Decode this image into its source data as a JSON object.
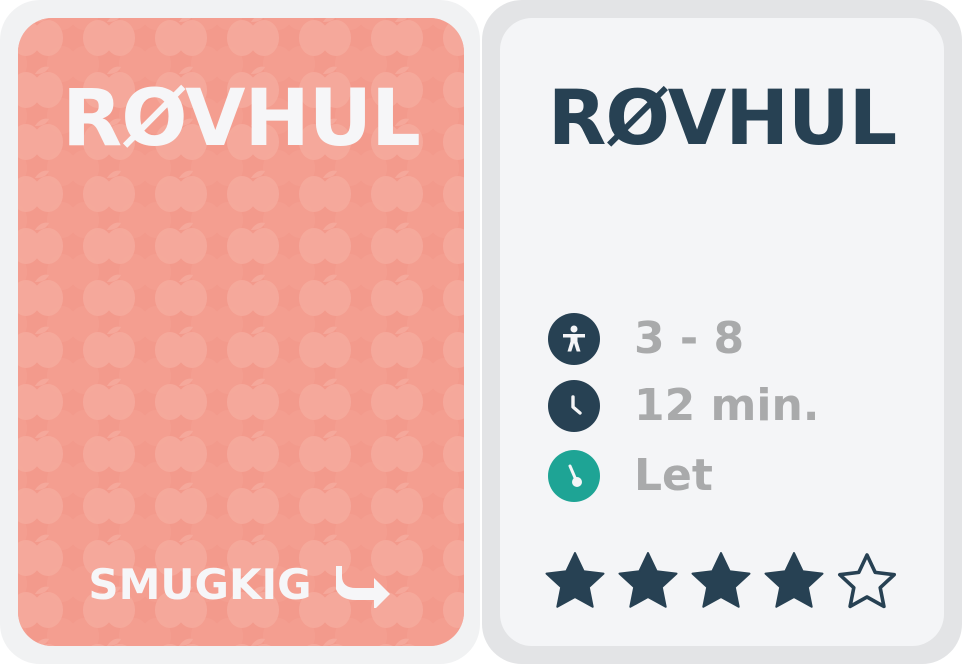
{
  "cover": {
    "title": "RØVHUL",
    "peek_label": "SMUGKIG",
    "peek_icon": "share-arrow-icon",
    "background_color": "#f39a8c"
  },
  "details": {
    "title": "RØVHUL",
    "players": {
      "icon": "person-icon",
      "value": "3 - 8"
    },
    "duration": {
      "icon": "clock-icon",
      "value": "12 min."
    },
    "difficulty": {
      "icon": "gauge-icon",
      "value": "Let",
      "color": "#1ea495"
    },
    "rating": {
      "filled": 4,
      "max": 5
    },
    "accent_color": "#274153"
  }
}
